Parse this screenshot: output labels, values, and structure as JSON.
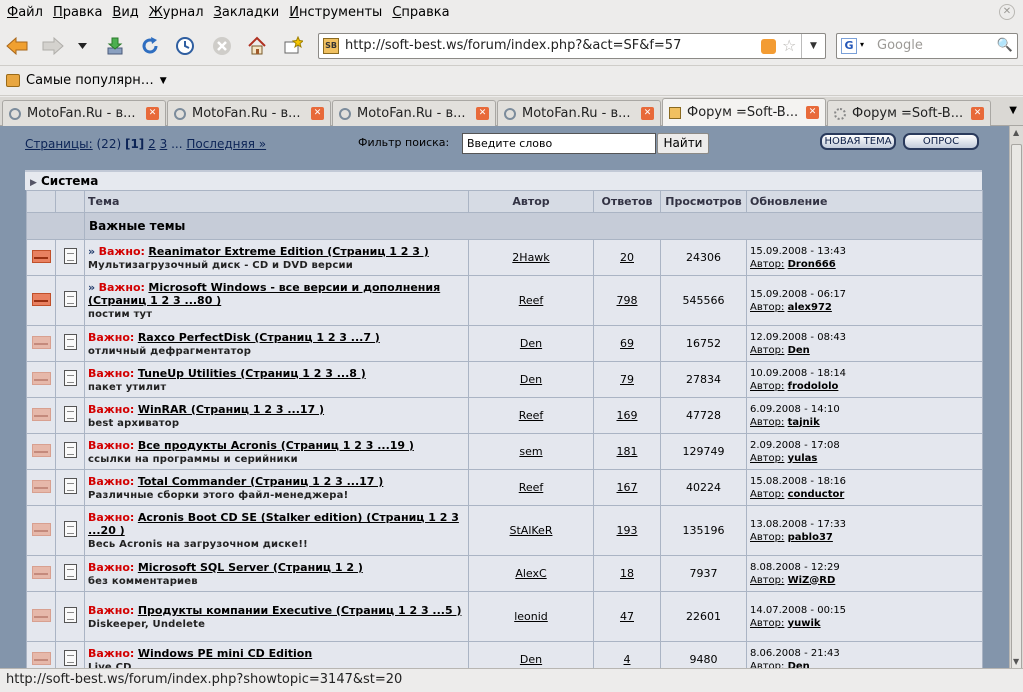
{
  "menu": [
    "Файл",
    "Правка",
    "Вид",
    "Журнал",
    "Закладки",
    "Инструменты",
    "Справка"
  ],
  "url": "http://soft-best.ws/forum/index.php?&act=SF&f=57",
  "search_placeholder": "Google",
  "search_engine_icon": "G",
  "bookmark": "Самые популярн…",
  "tabs": [
    {
      "title": "MotoFan.Ru - в...",
      "active": false
    },
    {
      "title": "MotoFan.Ru - в...",
      "active": false
    },
    {
      "title": "MotoFan.Ru - в...",
      "active": false
    },
    {
      "title": "MotoFan.Ru - в...",
      "active": false
    },
    {
      "title": "Форум =Soft-B...",
      "active": true
    },
    {
      "title": "Форум =Soft-B...",
      "active": false
    }
  ],
  "status": "http://soft-best.ws/forum/index.php?showtopic=3147&st=20",
  "forum": {
    "pages_label": "Страницы:",
    "pages_count": "(22)",
    "current_page": "[1]",
    "page2": "2",
    "page3": "3",
    "ellipsis": "...",
    "last": "Последняя »",
    "filter_label": "Фильтр поиска:",
    "filter_value": "Введите слово",
    "find_btn": "Найти",
    "new_topic": "НОВАЯ ТЕМА",
    "poll": "ОПРОС",
    "category": "Система",
    "headers": {
      "topic": "Тема",
      "author": "Автор",
      "replies": "Ответов",
      "views": "Просмотров",
      "updated": "Обновление"
    },
    "section": "Важные темы",
    "important": "Важно:",
    "author_prefix": "Автор:",
    "topics": [
      {
        "title": "Reanimator Extreme Edition (Страниц 1 2 3 )",
        "desc": "Мультизагрузочный диск - CD и DVD версии",
        "author": "2Hawk",
        "replies": "20",
        "views": "24306",
        "date": "15.09.2008 - 13:43",
        "last": "Dron666",
        "hot": true,
        "arrows": true
      },
      {
        "title": "Microsoft Windows - все версии и дополнения (Страниц 1 2 3 ...80 )",
        "desc": "постим тут",
        "author": "Reef",
        "replies": "798",
        "views": "545566",
        "date": "15.09.2008 - 06:17",
        "last": "alex972",
        "hot": true,
        "arrows": true
      },
      {
        "title": "Raxco PerfectDisk (Страниц 1 2 3 ...7 )",
        "desc": "отличный дефрагментатор",
        "author": "Den",
        "replies": "69",
        "views": "16752",
        "date": "12.09.2008 - 08:43",
        "last": "Den",
        "hot": false,
        "arrows": false
      },
      {
        "title": "TuneUp Utilities (Страниц 1 2 3 ...8 )",
        "desc": "пакет утилит",
        "author": "Den",
        "replies": "79",
        "views": "27834",
        "date": "10.09.2008 - 18:14",
        "last": "frodololo",
        "hot": false,
        "arrows": false
      },
      {
        "title": "WinRAR (Страниц 1 2 3 ...17 )",
        "desc": "best архиватор",
        "author": "Reef",
        "replies": "169",
        "views": "47728",
        "date": "6.09.2008 - 14:10",
        "last": "tajnik",
        "hot": false,
        "arrows": false
      },
      {
        "title": "Все продукты Acronis (Страниц 1 2 3 ...19 )",
        "desc": "ссылки на программы и серийники",
        "author": "sem",
        "replies": "181",
        "views": "129749",
        "date": "2.09.2008 - 17:08",
        "last": "yulas",
        "hot": false,
        "arrows": false
      },
      {
        "title": "Total Commander (Страниц 1 2 3 ...17 )",
        "desc": "Различные сборки этого файл-менеджера!",
        "author": "Reef",
        "replies": "167",
        "views": "40224",
        "date": "15.08.2008 - 18:16",
        "last": "conductor",
        "hot": false,
        "arrows": false
      },
      {
        "title": "Acronis Boot CD SE (Stalker edition) (Страниц 1 2 3 ...20 )",
        "desc": "Весь Acronis на загрузочном диске!!",
        "author": "StAlKeR",
        "replies": "193",
        "views": "135196",
        "date": "13.08.2008 - 17:33",
        "last": "pablo37",
        "hot": false,
        "arrows": false
      },
      {
        "title": "Microsoft SQL Server (Страниц 1 2 )",
        "desc": "без комментариев",
        "author": "AlexC",
        "replies": "18",
        "views": "7937",
        "date": "8.08.2008 - 12:29",
        "last": "WiZ@RD",
        "hot": false,
        "arrows": false
      },
      {
        "title": "Продукты компании Executive (Страниц 1 2 3 ...5 )",
        "desc": "Diskeeper, Undelete",
        "author": "leonid",
        "replies": "47",
        "views": "22601",
        "date": "14.07.2008 - 00:15",
        "last": "yuwik",
        "hot": false,
        "arrows": false
      },
      {
        "title": "Windows PE mini CD Edition",
        "desc": "Live CD",
        "author": "Den",
        "replies": "4",
        "views": "9480",
        "date": "8.06.2008 - 21:43",
        "last": "Den",
        "hot": false,
        "arrows": false
      }
    ]
  }
}
